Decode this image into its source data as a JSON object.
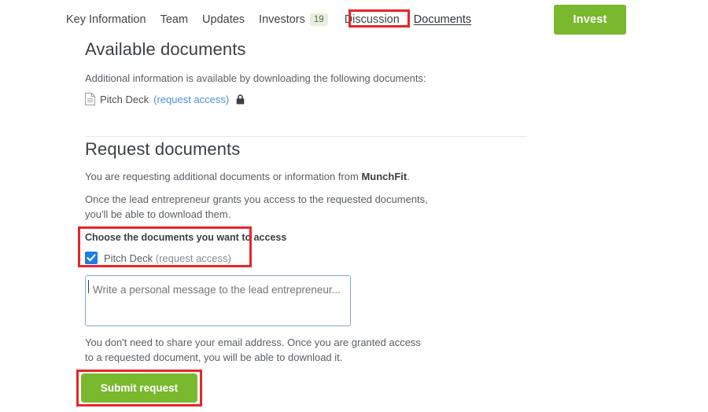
{
  "nav": {
    "items": [
      {
        "label": "Key Information",
        "name": "tab-key-information",
        "active": false
      },
      {
        "label": "Team",
        "name": "tab-team",
        "active": false
      },
      {
        "label": "Updates",
        "name": "tab-updates",
        "active": false
      },
      {
        "label": "Investors",
        "name": "tab-investors",
        "active": false,
        "badge": "19"
      },
      {
        "label": "Discussion",
        "name": "tab-discussion",
        "active": false
      },
      {
        "label": "Documents",
        "name": "tab-documents",
        "active": true
      }
    ],
    "investors_badge": "19",
    "key_information_label": "Key Information",
    "team_label": "Team",
    "updates_label": "Updates",
    "investors_label": "Investors",
    "discussion_label": "Discussion",
    "documents_label": "Documents"
  },
  "header": {
    "invest_label": "Invest"
  },
  "available": {
    "title": "Available documents",
    "intro": "Additional information is available by downloading the following documents:",
    "document": {
      "name": "Pitch Deck",
      "link": "(request access)",
      "file_icon": "document-icon",
      "lock_icon": "lock-icon"
    }
  },
  "request": {
    "title": "Request documents",
    "line1_prefix": "You are requesting additional documents or information from ",
    "company": "MunchFit",
    "line1_suffix": ".",
    "line2": "Once the lead entrepreneur grants you access to the requested documents, you'll be able to download them.",
    "choose_label": "Choose the documents you want to access",
    "checkbox": {
      "checked": true,
      "name": "Pitch Deck",
      "link": "(request access)"
    },
    "message_placeholder": "Write a personal message to the lead entrepreneur...",
    "message_value": "",
    "disclaimer": "You don't need to share your email address. Once you are granted access to a requested document, you will be able to download it.",
    "submit_label": "Submit request"
  },
  "colors": {
    "brand_green": "#7ab82e",
    "link_blue": "#4a90d9",
    "checkbox_blue": "#1a7ee8",
    "annotation_red": "#e8252a",
    "badge_green_bg": "#e6f1dd",
    "text_dark": "#3b4045",
    "text_muted": "#5a6067"
  },
  "annotations": {
    "documents_tab_highlight": "red-highlight-box",
    "choose_documents_highlight": "red-highlight-box",
    "submit_button_highlight": "red-highlight-box"
  }
}
